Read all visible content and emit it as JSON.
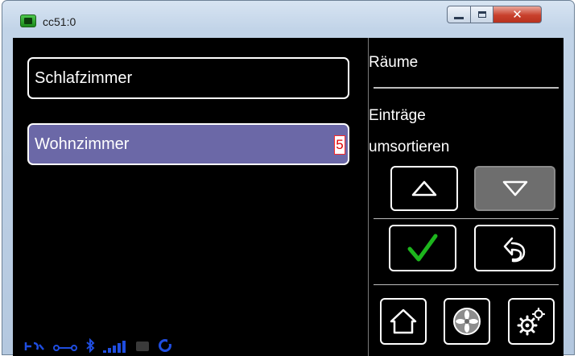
{
  "window": {
    "title": "cc51:0"
  },
  "list": {
    "items": [
      {
        "label": "Schlafzimmer",
        "selected": false
      },
      {
        "label": "Wohnzimmer",
        "selected": true,
        "badge": "5"
      }
    ]
  },
  "panel": {
    "title": "Räume",
    "text_line1": "Einträge",
    "text_line2": "umsortieren"
  },
  "buttons": {
    "up": "up-arrow-icon",
    "down": "down-arrow-icon",
    "confirm": "checkmark-icon",
    "back": "back-arrow-icon",
    "home": "home-icon",
    "fan": "fan-icon",
    "settings": "gears-icon"
  },
  "status_bar": {
    "icons": [
      "signal-arrows-icon",
      "link-icon",
      "bluetooth-icon",
      "signal-strength-icon",
      "grey-indicator-icon",
      "sync-icon"
    ]
  },
  "colors": {
    "selected_item": "#6b68a7",
    "confirm_check": "#1db51d",
    "status_blue": "#1f4de0"
  }
}
